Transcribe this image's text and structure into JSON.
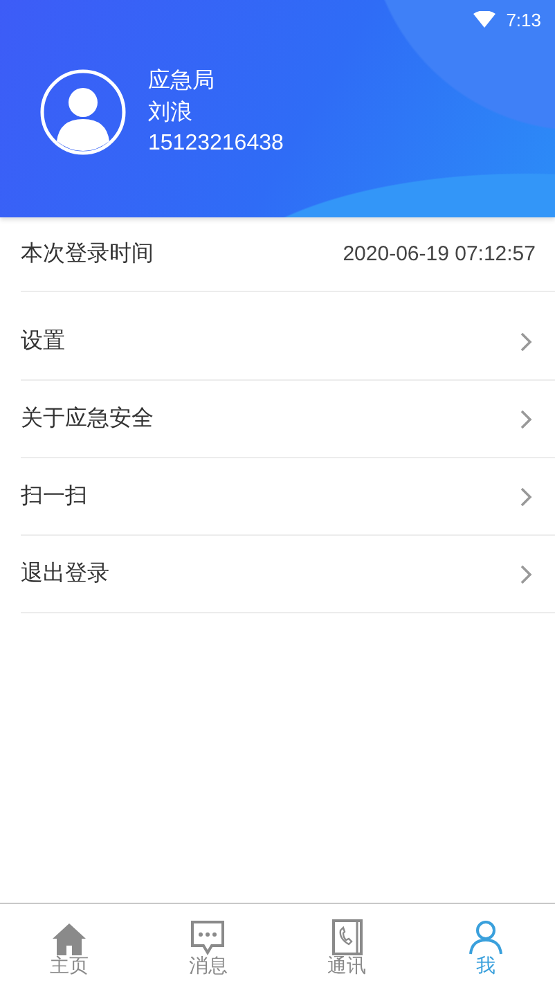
{
  "status_bar": {
    "time": "7:13"
  },
  "profile": {
    "organization": "应急局",
    "name": "刘浪",
    "phone": "15123216438"
  },
  "login_info": {
    "label": "本次登录时间",
    "value": "2020-06-19 07:12:57"
  },
  "menu": [
    {
      "label": "设置"
    },
    {
      "label": "关于应急安全"
    },
    {
      "label": "扫一扫"
    },
    {
      "label": "退出登录"
    }
  ],
  "tab_bar": [
    {
      "label": "主页",
      "selected": false
    },
    {
      "label": "消息",
      "selected": false
    },
    {
      "label": "通讯",
      "selected": false
    },
    {
      "label": "我",
      "selected": true
    }
  ]
}
